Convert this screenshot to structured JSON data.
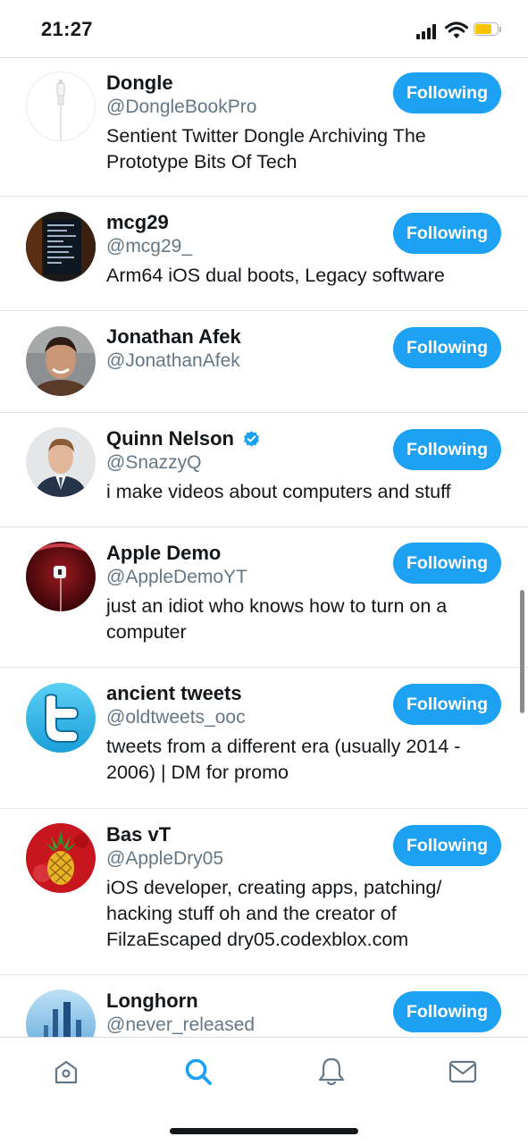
{
  "status_bar": {
    "time": "21:27"
  },
  "accounts": [
    {
      "name": "Dongle",
      "handle": "@DongleBookPro",
      "bio": "Sentient Twitter Dongle Archiving The Prototype Bits Of Tech",
      "follow_label": "Following",
      "avatar": "dongle-cable-avatar",
      "verified": false
    },
    {
      "name": "mcg29",
      "handle": "@mcg29_",
      "bio": "Arm64 iOS dual boots, Legacy software",
      "follow_label": "Following",
      "avatar": "terminal-screen-avatar",
      "verified": false
    },
    {
      "name": "Jonathan Afek",
      "handle": "@JonathanAfek",
      "bio": "",
      "follow_label": "Following",
      "avatar": "person-photo-avatar",
      "verified": false
    },
    {
      "name": "Quinn Nelson",
      "handle": "@SnazzyQ",
      "bio": "i make videos about computers and stuff",
      "follow_label": "Following",
      "avatar": "person-suit-avatar",
      "verified": true
    },
    {
      "name": "Apple Demo",
      "handle": "@AppleDemoYT",
      "bio": "just an idiot who knows how to turn on a computer",
      "follow_label": "Following",
      "avatar": "red-lock-avatar",
      "verified": false
    },
    {
      "name": "ancient tweets",
      "handle": "@oldtweets_ooc",
      "bio": "tweets from a different era (usually 2014 - 2006) | DM for promo",
      "follow_label": "Following",
      "avatar": "twitter-t-logo-avatar",
      "verified": false
    },
    {
      "name": "Bas vT",
      "handle": "@AppleDry05",
      "bio": "iOS developer, creating apps, patching/ hacking stuff oh and the creator of FilzaEscaped dry05.codexblox.com",
      "follow_label": "Following",
      "avatar": "pineapple-avatar",
      "verified": false
    },
    {
      "name": "Longhorn",
      "handle": "@never_released",
      "bio": "",
      "follow_label": "Following",
      "avatar": "blue-towers-avatar",
      "verified": false
    }
  ],
  "tab_bar": {
    "tabs": [
      {
        "icon": "home-icon",
        "active": false
      },
      {
        "icon": "search-icon",
        "active": true
      },
      {
        "icon": "bell-icon",
        "active": false
      },
      {
        "icon": "mail-icon",
        "active": false
      }
    ]
  },
  "colors": {
    "accent": "#1da1f2",
    "text": "#14171a",
    "secondary_text": "#657786",
    "divider": "#e1e8ed",
    "inactive_icon": "#657786"
  }
}
